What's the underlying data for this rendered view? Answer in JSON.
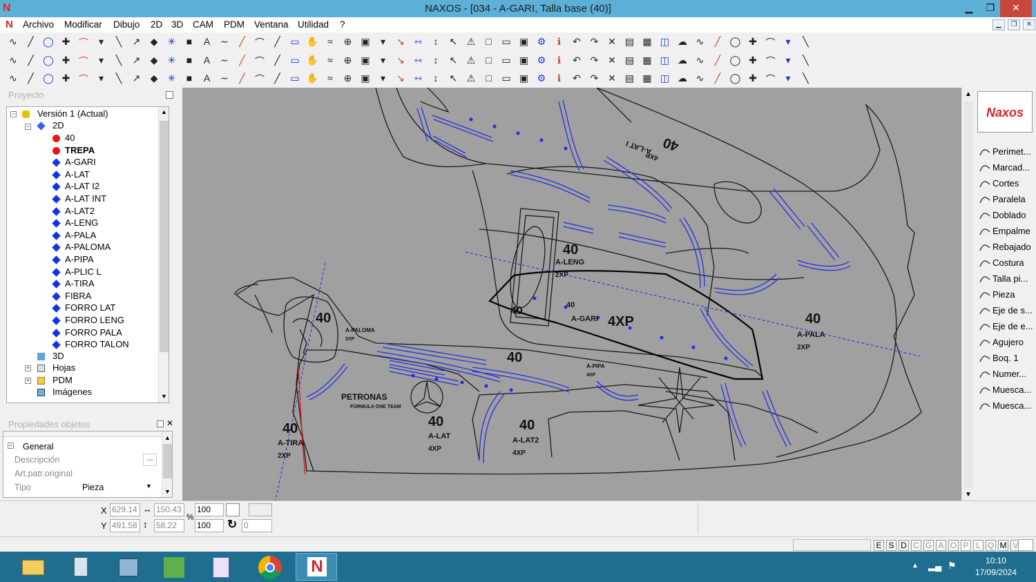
{
  "window": {
    "title": "NAXOS - [034 - A-GARI, Talla base (40)]",
    "controls": {
      "minimize": "▁",
      "maximize": "❐",
      "close": "✕"
    }
  },
  "menu": {
    "items": [
      "Archivo",
      "Modificar",
      "Dibujo",
      "2D",
      "3D",
      "CAM",
      "PDM",
      "Ventana",
      "Utilidad",
      "?"
    ]
  },
  "proyecto": {
    "header": "Proyecto",
    "tree": {
      "root": "Versión 1 (Actual)",
      "node_2d": "2D",
      "items": [
        "40",
        "TREPA",
        "A-GARI",
        "A-LAT",
        "A-LAT I2",
        "A-LAT INT",
        "A-LAT2",
        "A-LENG",
        "A-PALA",
        "A-PALOMA",
        "A-PIPA",
        "A-PLIC L",
        "A-TIRA",
        "FIBRA",
        "FORRO LAT",
        "FORRO LENG",
        "FORRO PALA",
        "FORRO TALON"
      ],
      "node_3d": "3D",
      "hojas": "Hojas",
      "pdm": "PDM",
      "imagenes": "Imágenes"
    }
  },
  "propiedades": {
    "header": "Propiedades objetos",
    "group": "General",
    "rows": [
      {
        "label": "Descripción",
        "value": ""
      },
      {
        "label": "Art.patr.original",
        "value": ""
      },
      {
        "label": "Tipo",
        "value": "Pieza"
      }
    ]
  },
  "right_panel": {
    "logo": "Naxos",
    "items": [
      "Perimet...",
      "Marcad...",
      "Cortes",
      "Paralela",
      "Doblado",
      "Empalme",
      "Rebajado",
      "Costura",
      "Talla pi...",
      "Pieza",
      "Eje de s...",
      "Eje de e...",
      "Agujero",
      "Boq. 1",
      "Numer...",
      "Muesca...",
      "Muesca..."
    ]
  },
  "drawing": {
    "labels": [
      {
        "t": "40",
        "k": "size"
      },
      {
        "t": "A-LENG",
        "k": "name"
      },
      {
        "t": "2XP",
        "k": "qty"
      },
      {
        "t": "40",
        "k": "size"
      },
      {
        "t": "A-GARI",
        "k": "name"
      },
      {
        "t": "4XP",
        "k": "qty"
      },
      {
        "t": "40",
        "k": "size"
      },
      {
        "t": "A-PALA",
        "k": "name"
      },
      {
        "t": "2XP",
        "k": "qty"
      },
      {
        "t": "40",
        "k": "size"
      },
      {
        "t": "A-PALOMA",
        "k": "name"
      },
      {
        "t": "2XP",
        "k": "qty"
      },
      {
        "t": "40",
        "k": "size"
      },
      {
        "t": "A-PIPA",
        "k": "name"
      },
      {
        "t": "4XP",
        "k": "qty"
      },
      {
        "t": "40",
        "k": "size"
      },
      {
        "t": "A-TIRA",
        "k": "name"
      },
      {
        "t": "2XP",
        "k": "qty"
      },
      {
        "t": "40",
        "k": "size"
      },
      {
        "t": "A-LAT",
        "k": "name"
      },
      {
        "t": "4XP",
        "k": "qty"
      },
      {
        "t": "40",
        "k": "size"
      },
      {
        "t": "A-LAT2",
        "k": "name"
      },
      {
        "t": "4XP",
        "k": "qty"
      },
      {
        "t": "40",
        "k": "size"
      },
      {
        "t": "A-LAT I",
        "k": "name"
      },
      {
        "t": "4XP",
        "k": "qty"
      },
      {
        "t": "40",
        "k": "size"
      }
    ],
    "petronas_1": "PETRONAS",
    "petronas_2": "FORMULA ONE TEAM"
  },
  "coords": {
    "x": "629.14",
    "w": "150.43",
    "scale_x": "100",
    "y": "491.58",
    "h": "58.22",
    "scale_y": "100",
    "rotation": "0",
    "percent": "%"
  },
  "status_letters": [
    "E",
    "S",
    "D",
    "C",
    "G",
    "A",
    "O",
    "P",
    "L",
    "Q",
    "M",
    "V"
  ],
  "clock": {
    "time": "10:10",
    "date": "17/09/2024"
  }
}
